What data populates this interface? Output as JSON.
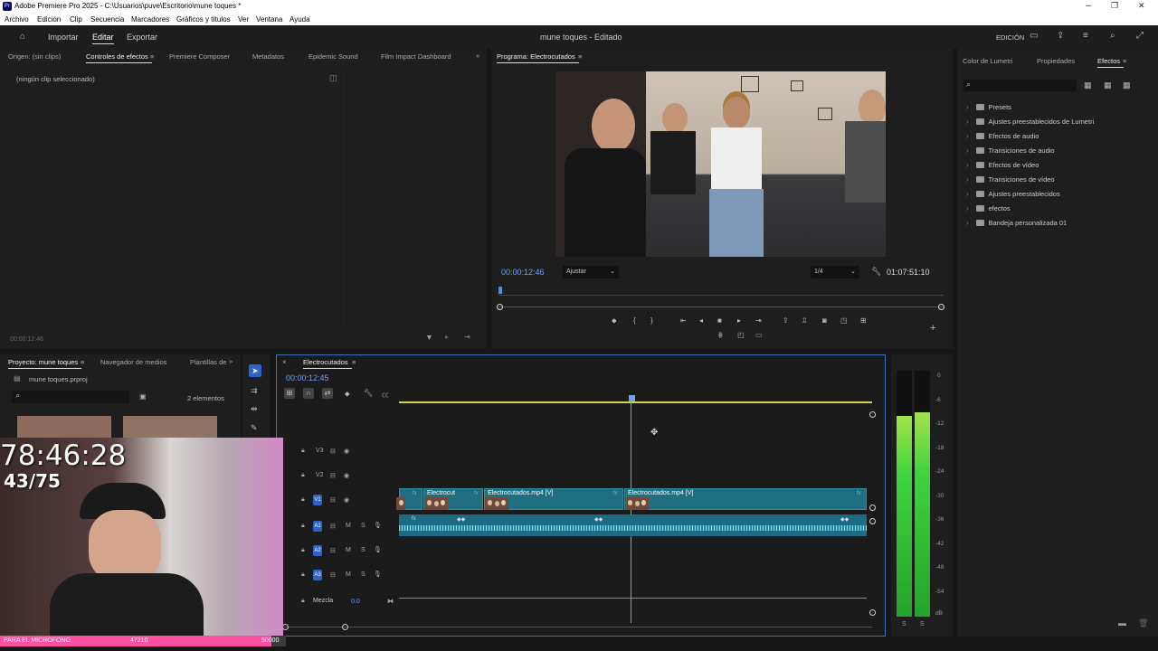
{
  "window": {
    "title": "Adobe Premiere Pro 2025 - C:\\Usuarios\\puve\\Escritorio\\mune toques *"
  },
  "menu": [
    "Archivo",
    "Edición",
    "Clip",
    "Secuencia",
    "Marcadores",
    "Gráficos y títulos",
    "Ver",
    "Ventana",
    "Ayuda"
  ],
  "workspace": {
    "nav": [
      "Importar",
      "Editar",
      "Exportar"
    ],
    "project_title": "mune toques - Editado",
    "mode": "EDICIÓN"
  },
  "source_panel": {
    "tabs": [
      "Origen: (sin clips)",
      "Controles de efectos",
      "Premiere Composer",
      "Metadatos",
      "Epidemic Sound",
      "Film Impact Dashboard"
    ],
    "no_clip": "(ningún clip seleccionado)",
    "timecode": "00:00:12:46"
  },
  "program_panel": {
    "tab": "Programa: Electrocutados",
    "timecode": "00:00:12:46",
    "fit": "Ajustar",
    "resolution": "1/4",
    "duration": "01:07:51:10"
  },
  "right_panel": {
    "tabs": [
      "Color de Lumetri",
      "Propiedades",
      "Efectos"
    ],
    "effects": [
      "Presets",
      "Ajustes preestablecidos de Lumetri",
      "Efectos de audio",
      "Transiciones de audio",
      "Efectos de vídeo",
      "Transiciones de vídeo",
      "Ajustes preestablecidos",
      "efectos",
      "Bandeja personalizada 01"
    ]
  },
  "project_panel": {
    "tabs": [
      "Proyecto: mune toques",
      "Navegador de medios",
      "Plantillas de"
    ],
    "file": "mune toques.prproj",
    "count": "2 elementos"
  },
  "timeline": {
    "tab": "Electrocutados",
    "timecode": "00:00:12:45",
    "video_tracks": [
      "V3",
      "V2",
      "V1"
    ],
    "audio_tracks": [
      "A1",
      "A2",
      "A3"
    ],
    "mix_label": "Mezcla",
    "mix_value": "0.0",
    "clips": [
      "Electrocut",
      "Electrocutados.mp4 [V]",
      "Electrocutados.mp4 [V]"
    ]
  },
  "meter_scale": [
    "0",
    "-6",
    "-12",
    "-18",
    "-24",
    "-30",
    "-36",
    "-42",
    "-48",
    "-54",
    "dB"
  ],
  "meter_footer": [
    "S",
    "S"
  ],
  "overlay": {
    "big_timer": "78:46:28",
    "counter": "43/75",
    "bar_text": "PARA EL MICROFONO",
    "bar_value": "47210",
    "bar_goal": "50000"
  },
  "colors": {
    "accent": "#4a90e2",
    "clip": "#1f6f80",
    "playhead": "#6aa0ff",
    "pink": "#ff4fa0"
  }
}
